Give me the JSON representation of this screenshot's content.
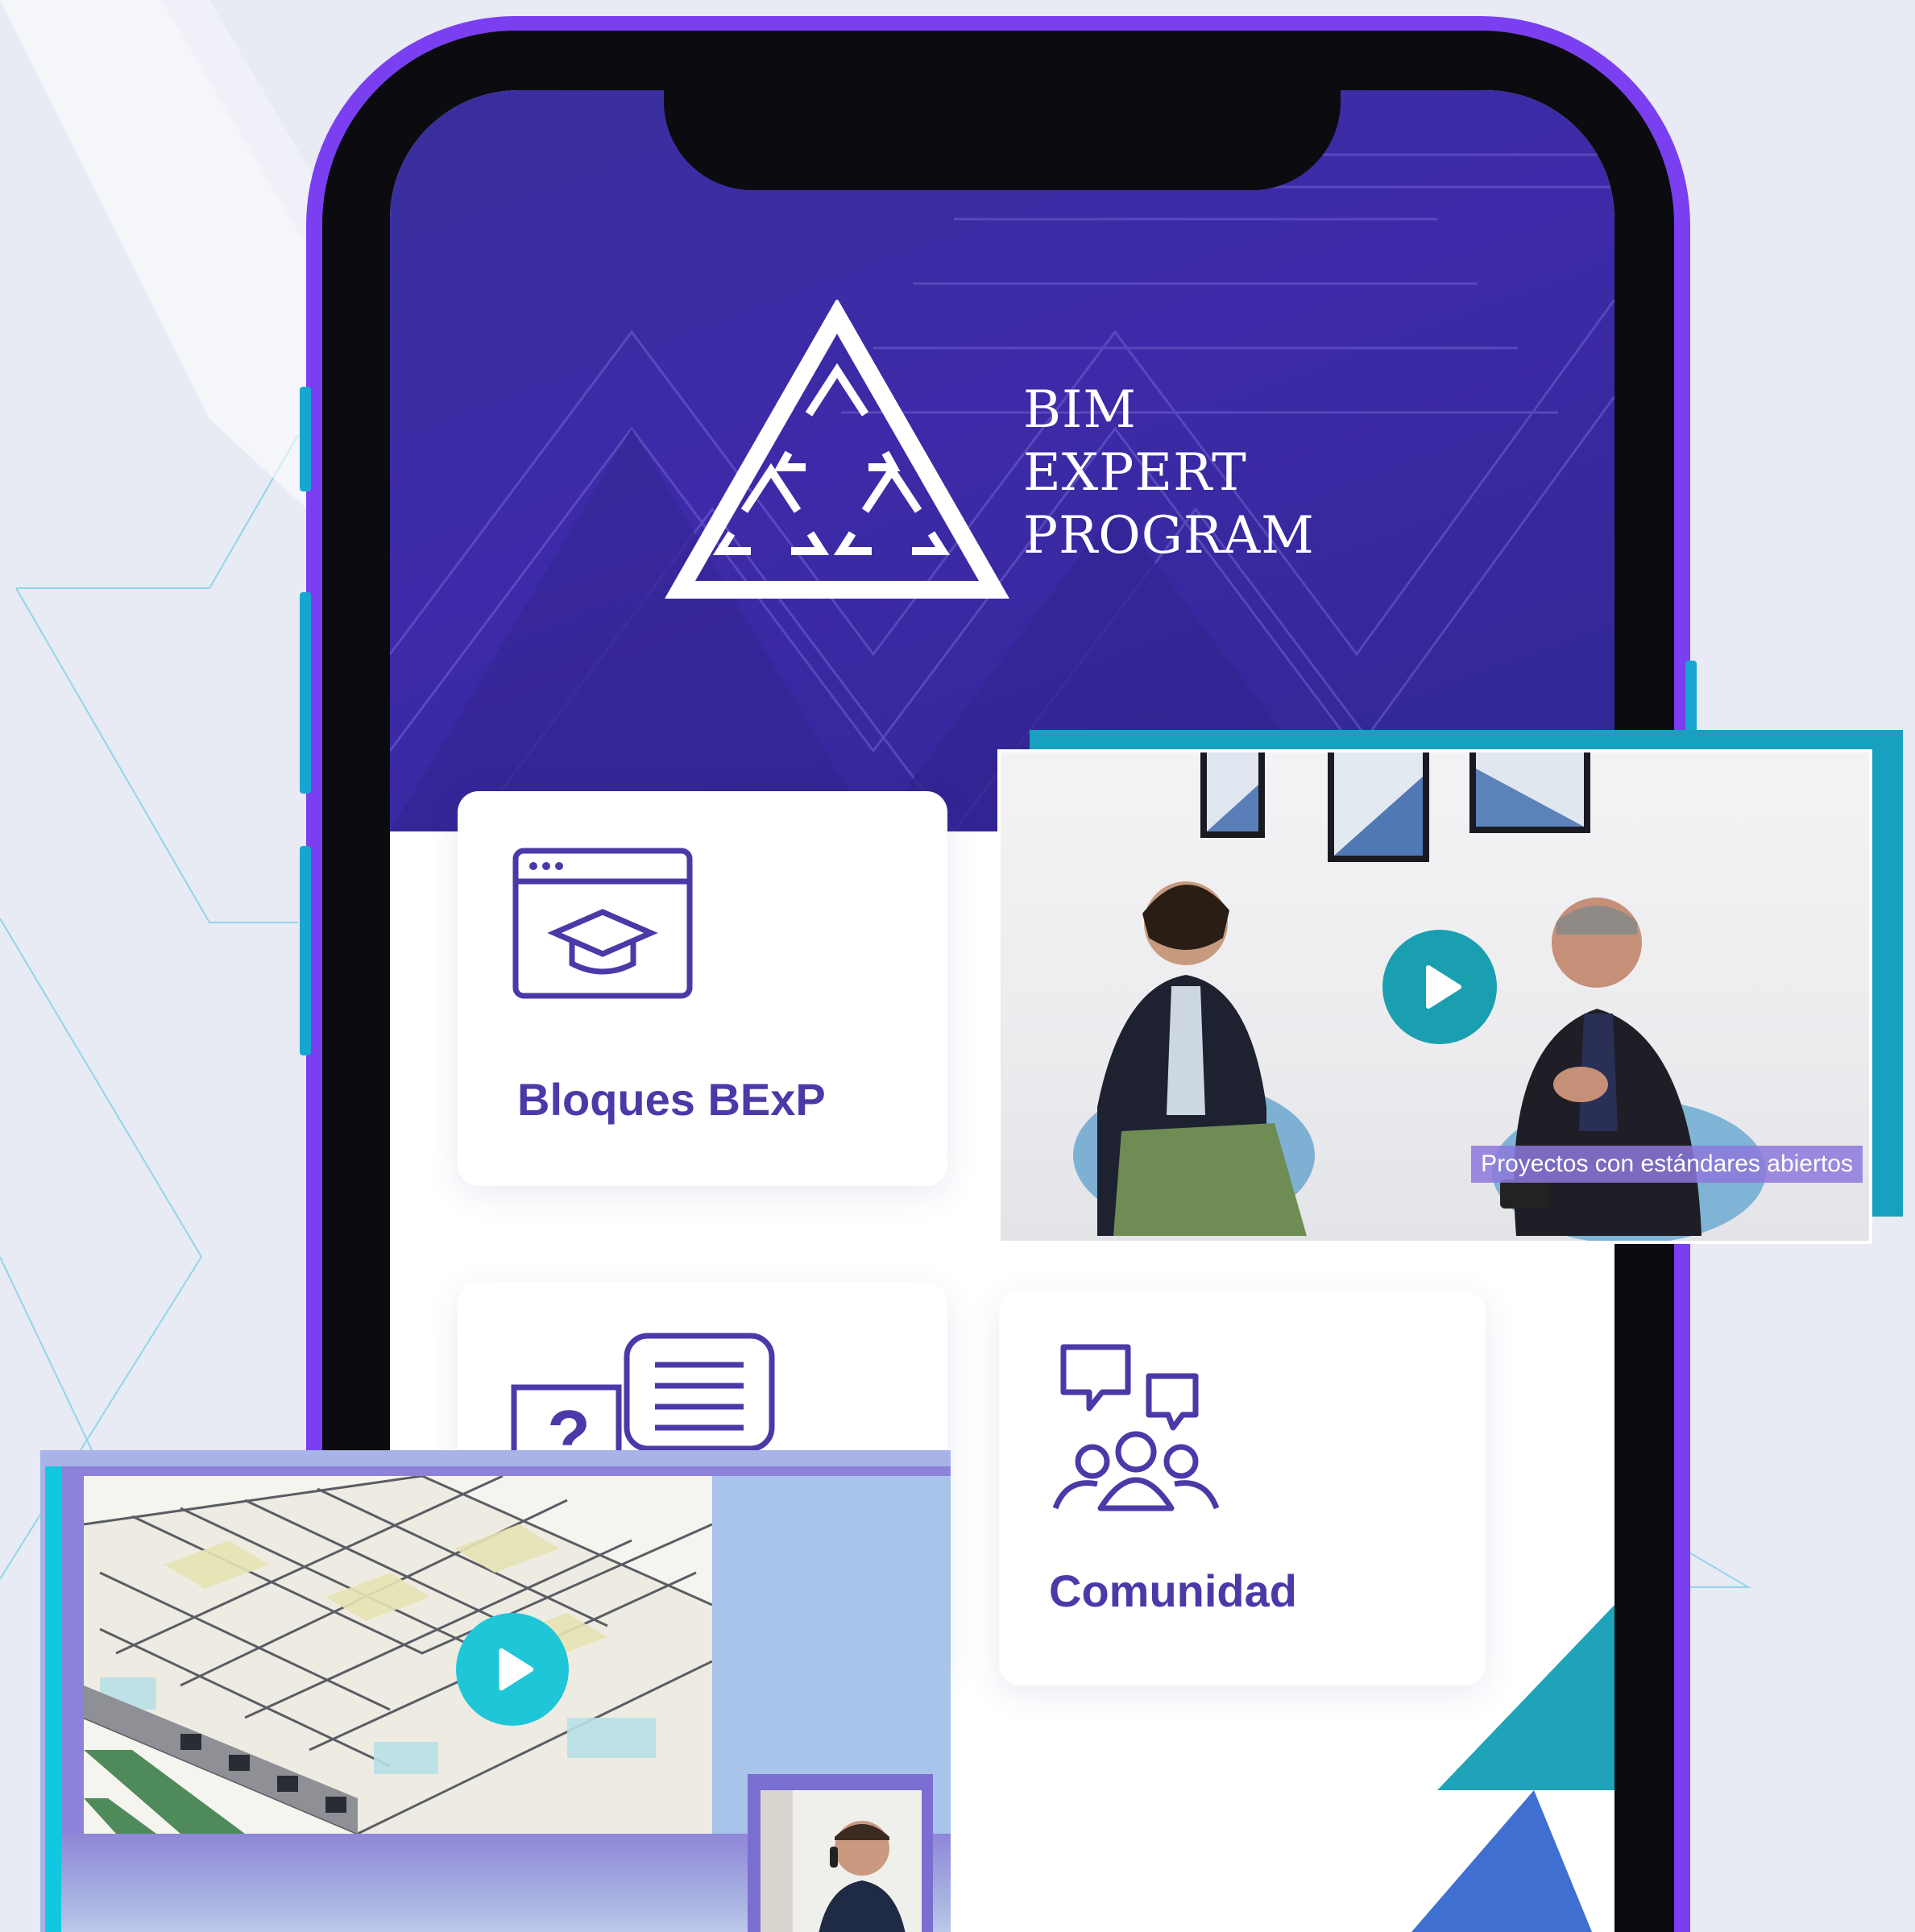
{
  "brand": {
    "line1": "BIM",
    "line2": "EXPERT",
    "line3": "PROGRAM"
  },
  "cards": {
    "bloques_label": "Bloques BExP",
    "comunidad_label": "Comunidad"
  },
  "video1": {
    "caption": "Proyectos con estándares abiertos"
  },
  "icons": {
    "logo": "triangle-logo-icon",
    "bloques": "browser-graduation-cap-icon",
    "faq": "question-chat-icon",
    "comunidad": "community-chat-icon",
    "play": "play-icon"
  },
  "colors": {
    "phone_frame": "#7a3ff0",
    "header_bg": "#3a2f9e",
    "accent_teal": "#1fa3b8",
    "label_purple": "#4a3aa8",
    "play_button": "#1a9fb0"
  }
}
